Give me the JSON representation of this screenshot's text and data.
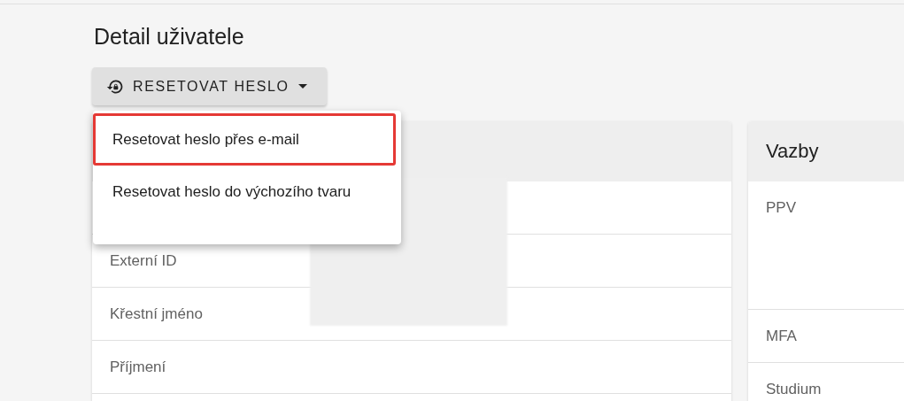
{
  "page_title": "Detail uživatele",
  "reset_button": {
    "label": "RESETOVAT HESLO"
  },
  "reset_menu": {
    "items": [
      {
        "label": "Resetovat heslo přes e-mail",
        "selected": true
      },
      {
        "label": "Resetovat heslo do výchozího tvaru",
        "selected": false
      }
    ]
  },
  "detail_card": {
    "rows": [
      {
        "label": ""
      },
      {
        "label": "Externí ID"
      },
      {
        "label": "Křestní jméno"
      },
      {
        "label": "Příjmení"
      },
      {
        "label": ""
      }
    ]
  },
  "relations_card": {
    "title": "Vazby",
    "rows": [
      {
        "label": "PPV",
        "kind": "tall"
      },
      {
        "label": "MFA",
        "kind": "normal"
      },
      {
        "label": "Studium",
        "kind": "normal"
      }
    ]
  }
}
